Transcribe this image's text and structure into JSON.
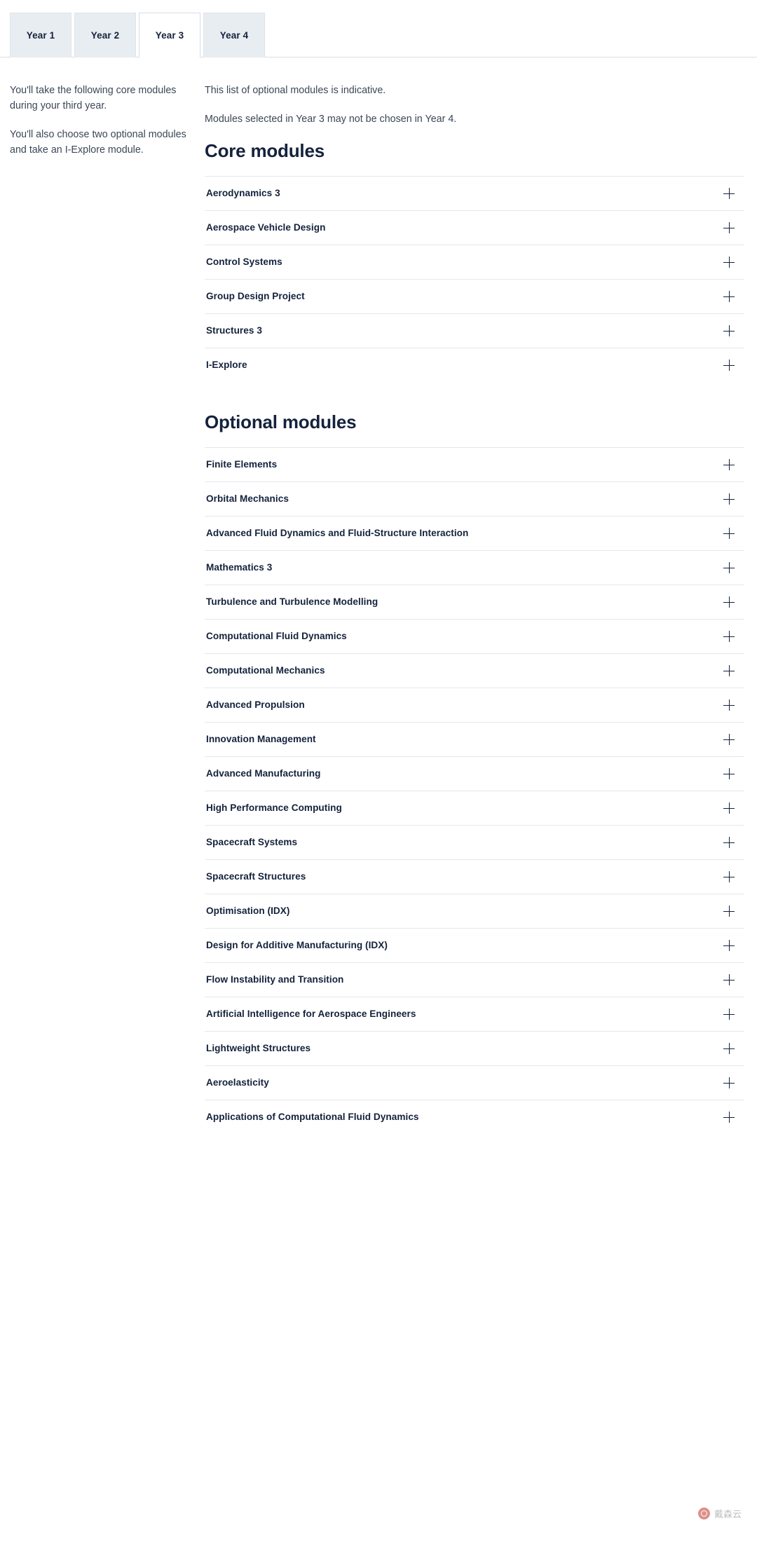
{
  "tabs": [
    {
      "label": "Year 1",
      "active": false
    },
    {
      "label": "Year 2",
      "active": false
    },
    {
      "label": "Year 3",
      "active": true
    },
    {
      "label": "Year 4",
      "active": false
    }
  ],
  "left_column": {
    "paragraph_1": "You'll take the following core modules during your third year.",
    "paragraph_2": "You'll also choose two optional modules and take an I-Explore module."
  },
  "right_column": {
    "note_1": "This list of optional modules is indicative.",
    "note_2": "Modules selected in Year 3 may not be chosen in Year 4.",
    "core_heading": "Core modules",
    "optional_heading": "Optional modules",
    "expand_icon": "plus-icon",
    "core_modules": [
      "Aerodynamics 3",
      "Aerospace Vehicle Design",
      "Control Systems",
      "Group Design Project",
      "Structures 3",
      "I-Explore"
    ],
    "optional_modules": [
      "Finite Elements",
      "Orbital Mechanics",
      "Advanced Fluid Dynamics and Fluid-Structure Interaction",
      "Mathematics 3",
      "Turbulence and Turbulence Modelling",
      "Computational Fluid Dynamics",
      "Computational Mechanics",
      "Advanced Propulsion",
      "Innovation Management",
      "Advanced Manufacturing",
      "High Performance Computing",
      "Spacecraft Systems",
      "Spacecraft Structures",
      "Optimisation (IDX)",
      "Design for Additive Manufacturing (IDX)",
      "Flow Instability and Transition",
      "Artificial Intelligence for Aerospace Engineers",
      "Lightweight Structures",
      "Aeroelasticity",
      "Applications of Computational Fluid Dynamics"
    ]
  },
  "watermark": {
    "text": "戴森云"
  },
  "colors": {
    "heading": "#14223c",
    "body_text": "#3c4757",
    "tab_inactive_bg": "#e8edf1",
    "rule": "#e4e7ea"
  }
}
